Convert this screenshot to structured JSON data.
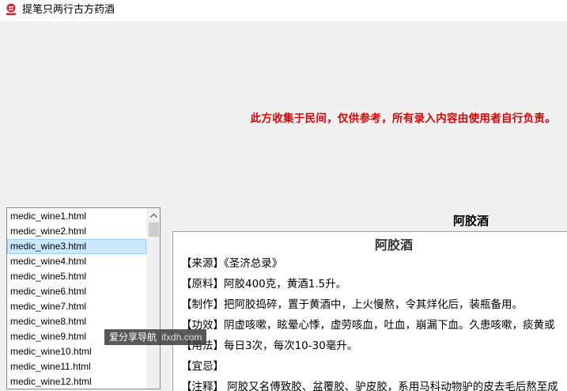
{
  "window": {
    "title": "提笔只两行古方药酒"
  },
  "disclaimer": "此方收集于民间，仅供参考，所有录入内容由使用者自行负责。",
  "file_list": {
    "items": [
      "medic_wine1.html",
      "medic_wine2.html",
      "medic_wine3.html",
      "medic_wine4.html",
      "medic_wine5.html",
      "medic_wine6.html",
      "medic_wine7.html",
      "medic_wine8.html",
      "medic_wine9.html",
      "medic_wine10.html",
      "medic_wine11.html",
      "medic_wine12.html"
    ],
    "selected_index": 2
  },
  "article": {
    "title": "阿胶酒",
    "heading": "阿胶酒",
    "lines": [
      "【来源】《圣济总录》",
      "【原料】阿胶400克，黄酒1.5升。",
      "【制作】把阿胶捣碎，置于黄酒中，上火慢熬，令其烊化后，装瓶备用。",
      "【功效】阴虚咳嗽，眩晕心悸，虚劳咳血，吐血，崩漏下血。久患咳嗽，痰黄或",
      "【用法】每日3次，每次10-30毫升。",
      "【宜忌】",
      "【注释】 阿胶又名傅致胶、盆覆胶、驴皮胶，系用马科动物驴的皮去毛后熬至成"
    ]
  },
  "watermark": {
    "text": "爱分享导航",
    "url": "ifxdh.com"
  },
  "colors": {
    "disclaimer": "#e00000",
    "selection": "#cce8ff"
  }
}
